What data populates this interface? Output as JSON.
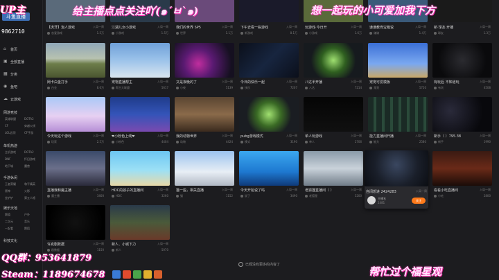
{
  "sidebar": {
    "logo": "斗鱼直播",
    "room_id": "9862710",
    "nav": [
      {
        "label": "首页",
        "icon": "home-icon",
        "glyph": "⌂"
      },
      {
        "label": "全部直播",
        "icon": "live-icon",
        "glyph": "▣"
      },
      {
        "label": "分类",
        "icon": "category-icon",
        "glyph": "▦"
      },
      {
        "label": "鱼吧",
        "icon": "fish-icon",
        "glyph": "◉"
      },
      {
        "label": "云游戏",
        "icon": "cloud-game-icon",
        "glyph": "☁"
      }
    ],
    "sections": [
      {
        "title": "网游竞技",
        "items": [
          "英雄联盟",
          "DOTA2",
          "CF",
          "穿越火线",
          "LOL云顶",
          "CF手游"
        ]
      },
      {
        "title": "单机热游",
        "items": [
          "主机游戏",
          "DOTA2",
          "DNF",
          "怀旧游戏",
          "地下城",
          "魔兽"
        ]
      },
      {
        "title": "手游休闲",
        "items": [
          "王者荣耀",
          "和平精英",
          "原神",
          "火影",
          "金铲铲",
          "第五人格"
        ]
      },
      {
        "title": "娱乐天地",
        "items": [
          "颜值",
          "户外",
          "二次元",
          "音乐",
          "一起看",
          "舞蹈"
        ]
      },
      {
        "title": "科技文化",
        "items": []
      }
    ]
  },
  "overlays": {
    "top_left": "UP主",
    "top_center": "给主播点点关注吖(๑´ㅂ`๑)",
    "top_right": "想一起玩的小可爱加我下方",
    "qq": "QQ群：953641879",
    "steam": "Steam：1189674678",
    "bottom_right": "帮忙过个福星观"
  },
  "top_row": [
    {
      "title": "【虎牙】泡人游戏",
      "right": "入局一周",
      "meta": "恋爱游戏",
      "count": "1.5万"
    },
    {
      "title": "江湖儿女小游戏",
      "right": "入局一周",
      "meta": "小游戏",
      "count": "1.5万"
    },
    {
      "title": "我们的世界 SP5",
      "right": "入局一周",
      "meta": "世界",
      "count": "1.1万"
    },
    {
      "title": "下午去看一些游戏",
      "right": "入局一周",
      "meta": "新游戏",
      "count": "8.1万"
    },
    {
      "title": "玩游戏·今日开",
      "right": "入局一周",
      "meta": "小游戏",
      "count": "1.6万"
    },
    {
      "title": "谦谦教育宝箱说",
      "right": "入局一周",
      "meta": "谦谦",
      "count": "1.4万"
    },
    {
      "title": "新·球友·开播",
      "right": "入局一周",
      "meta": "球友",
      "count": "1.3万"
    }
  ],
  "rows": [
    [
      {
        "title": "网卡白金打手",
        "right": "入局一周",
        "meta": "白金",
        "count": "8.6万",
        "thumb": "pubg"
      },
      {
        "title": "宠物直播帮主",
        "right": "入局一周",
        "meta": "帮主大联盟",
        "count": "5617",
        "thumb": "mc"
      },
      {
        "title": "又是夜晚的了",
        "right": "入局一周",
        "meta": "小夜",
        "count": "5139",
        "thumb": "neon"
      },
      {
        "title": "今日的快乐一起",
        "right": "入局一周",
        "meta": "快乐",
        "count": "7207",
        "thumb": "track"
      },
      {
        "title": "八达半开播",
        "right": "入局一周",
        "meta": "八达",
        "count": "7214",
        "thumb": "green"
      },
      {
        "title": "宠宠可爱模板",
        "right": "入局一周",
        "meta": "宠宠",
        "count": "5720",
        "thumb": "sky"
      },
      {
        "title": "有玩后 不知道玩",
        "right": "入局一周",
        "meta": "有玩",
        "count": "4508",
        "thumb": "dark"
      }
    ],
    [
      {
        "title": "今天玩这个游戏",
        "right": "入局一周",
        "meta": "玩家",
        "count": "2.5万",
        "thumb": "cartoon"
      },
      {
        "title": "❤小粉色上线❤",
        "right": "入局一周",
        "meta": "小粉色",
        "count": "4404",
        "thumb": "blueroom"
      },
      {
        "title": "我的动物世界",
        "right": "入局一周",
        "meta": "动物",
        "count": "4424",
        "thumb": "brown"
      },
      {
        "title": "pubg游戏模式",
        "right": "入局一周",
        "meta": "模式",
        "count": "3190",
        "thumb": "green2"
      },
      {
        "title": "单人玩游戏",
        "right": "入局一周",
        "meta": "单人",
        "count": "2706",
        "thumb": "black"
      },
      {
        "title": "能力直播间开播",
        "right": "入局一周",
        "meta": "能力",
        "count": "2580",
        "thumb": "slots"
      },
      {
        "title": "新手（ ）795.38",
        "right": "入局一周",
        "meta": "新手",
        "count": "1990",
        "thumb": "space"
      }
    ],
    [
      {
        "title": "直播我和魔主播",
        "right": "入局一周",
        "meta": "魔主播",
        "count": "3400",
        "thumb": "anime"
      },
      {
        "title": "HDC的孩子的直播间",
        "right": "入局一周",
        "meta": "HDC",
        "count": "3260",
        "thumb": "beach"
      },
      {
        "title": "猫一些，相关直播",
        "right": "入局一周",
        "meta": "猫",
        "count": "1152",
        "thumb": "char"
      },
      {
        "title": "今天开始说了吗",
        "right": "入局一周",
        "meta": "说了",
        "count": "3490",
        "thumb": "seablue"
      },
      {
        "title": "老狐狸直播间（ ）",
        "right": "入局一周",
        "meta": "老狐狸",
        "count": "5200",
        "thumb": "ui"
      },
      {
        "title": "",
        "right": "",
        "meta": "",
        "count": "",
        "thumb": "none"
      },
      {
        "title": "看看小吃直播间",
        "right": "入局一周",
        "meta": "小吃",
        "count": "2800",
        "thumb": "red"
      }
    ],
    [
      {
        "title": "许克剧数据",
        "right": "入局一周",
        "meta": "剧数据",
        "count": "1150",
        "thumb": "stars"
      },
      {
        "title": "新人、小城下力",
        "right": "入局一周",
        "meta": "新人",
        "count": "5070",
        "thumb": "battle"
      }
    ]
  ],
  "hover_card": {
    "title": "自闭想进 2424283",
    "right": "入局一周",
    "name": "主播名",
    "count": "2481",
    "follow_label": "关注"
  },
  "end_message": "已经没有更多的内容了",
  "taskbar_colors": [
    "#3a7bd5",
    "#e14b2e",
    "#4aa34a",
    "#e2b02e",
    "#d8602d"
  ]
}
